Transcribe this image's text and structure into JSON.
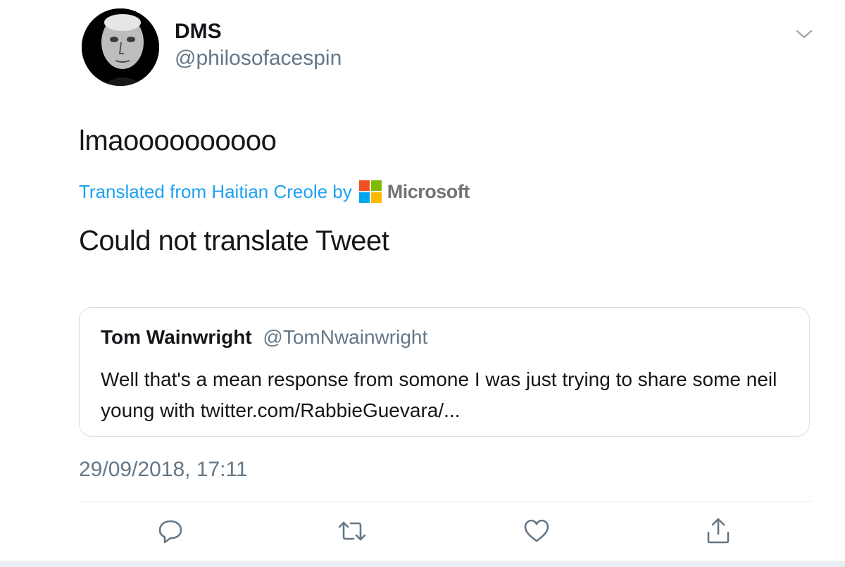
{
  "tweet": {
    "author": {
      "display_name": "DMS",
      "handle": "@philosofacespin"
    },
    "text": "lmaoooooooooo",
    "translation": {
      "label": "Translated from Haitian Creole by",
      "provider": "Microsoft",
      "result": "Could not translate Tweet"
    },
    "quoted_tweet": {
      "author_name": "Tom Wainwright",
      "author_handle": "@TomNwainwright",
      "text": "Well that's a mean response from somone I was just trying to share some neil young with twitter.com/RabbieGuevara/..."
    },
    "timestamp": "29/09/2018, 17:11",
    "actions": [
      {
        "name": "reply",
        "icon": "reply-icon"
      },
      {
        "name": "retweet",
        "icon": "retweet-icon"
      },
      {
        "name": "like",
        "icon": "heart-icon"
      },
      {
        "name": "share",
        "icon": "share-icon"
      }
    ]
  },
  "colors": {
    "link": "#1da1f2",
    "secondary_text": "#657786",
    "primary_text": "#14171a",
    "icon": "#657786",
    "ms_red": "#f25022",
    "ms_green": "#7fba00",
    "ms_blue": "#00a4ef",
    "ms_yellow": "#ffb900"
  }
}
